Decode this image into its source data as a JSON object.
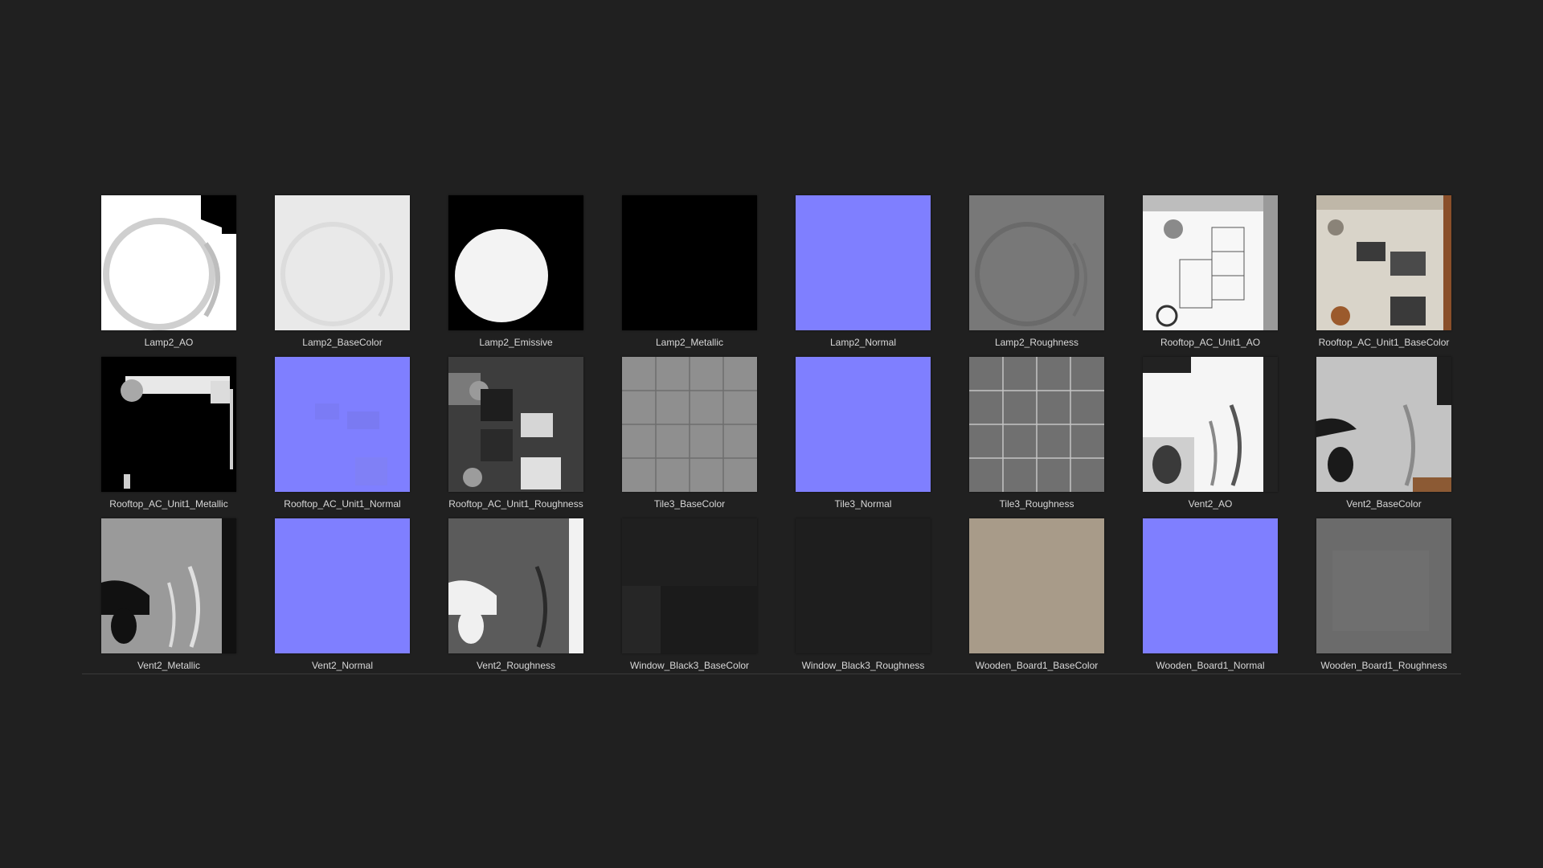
{
  "textures": [
    {
      "name": "Lamp2_AO",
      "kind": "ao-lamp"
    },
    {
      "name": "Lamp2_BaseColor",
      "kind": "lamp-base"
    },
    {
      "name": "Lamp2_Emissive",
      "kind": "lamp-emissive"
    },
    {
      "name": "Lamp2_Metallic",
      "kind": "black"
    },
    {
      "name": "Lamp2_Normal",
      "kind": "normal"
    },
    {
      "name": "Lamp2_Roughness",
      "kind": "lamp-rough"
    },
    {
      "name": "Rooftop_AC_Unit1_AO",
      "kind": "roof-ao"
    },
    {
      "name": "Rooftop_AC_Unit1_BaseColor",
      "kind": "roof-base"
    },
    {
      "name": "Rooftop_AC_Unit1_Metallic",
      "kind": "roof-metal"
    },
    {
      "name": "Rooftop_AC_Unit1_Normal",
      "kind": "normal-detail"
    },
    {
      "name": "Rooftop_AC_Unit1_Roughness",
      "kind": "roof-rough"
    },
    {
      "name": "Tile3_BaseColor",
      "kind": "tile"
    },
    {
      "name": "Tile3_Normal",
      "kind": "normal"
    },
    {
      "name": "Tile3_Roughness",
      "kind": "tile-rough"
    },
    {
      "name": "Vent2_AO",
      "kind": "vent-ao"
    },
    {
      "name": "Vent2_BaseColor",
      "kind": "vent-base"
    },
    {
      "name": "Vent2_Metallic",
      "kind": "vent-metal"
    },
    {
      "name": "Vent2_Normal",
      "kind": "normal"
    },
    {
      "name": "Vent2_Roughness",
      "kind": "vent-rough"
    },
    {
      "name": "Window_Black3_BaseColor",
      "kind": "window"
    },
    {
      "name": "Window_Black3_Roughness",
      "kind": "window-rough"
    },
    {
      "name": "Wooden_Board1_BaseColor",
      "kind": "wood"
    },
    {
      "name": "Wooden_Board1_Normal",
      "kind": "normal"
    },
    {
      "name": "Wooden_Board1_Roughness",
      "kind": "wood-rough"
    }
  ],
  "colors": {
    "background": "#202020",
    "label": "#d8d8d8",
    "normal_map": "#7f7fff"
  }
}
